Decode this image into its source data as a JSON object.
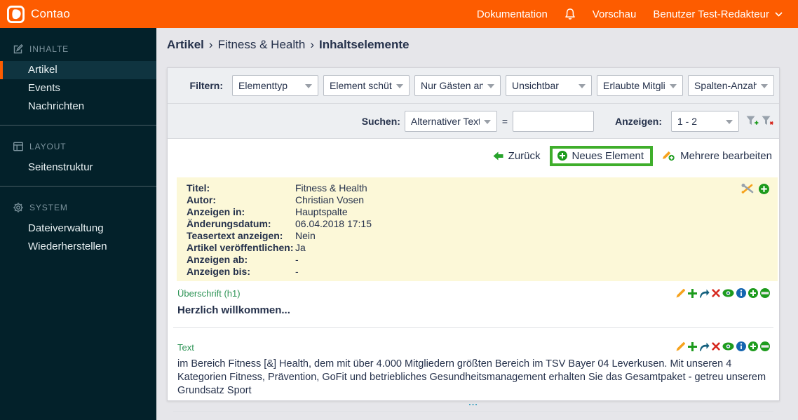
{
  "colors": {
    "accent_orange": "#fd5c00",
    "sidebar_bg": "#03212a",
    "highlight_green": "#3fae2b",
    "info_box_yellow": "#fcf8d8",
    "element_type_green": "#2e9456",
    "text_dark": "#25314b"
  },
  "header": {
    "brand": "Contao",
    "docs_label": "Dokumentation",
    "preview_label": "Vorschau",
    "user_label": "Benutzer Test-Redakteur"
  },
  "sidebar": {
    "sections": [
      {
        "label": "INHALTE",
        "items": [
          {
            "label": "Artikel",
            "active": true
          },
          {
            "label": "Events",
            "active": false
          },
          {
            "label": "Nachrichten",
            "active": false
          }
        ]
      },
      {
        "label": "LAYOUT",
        "items": [
          {
            "label": "Seitenstruktur",
            "active": false
          }
        ]
      },
      {
        "label": "SYSTEM",
        "items": [
          {
            "label": "Dateiverwaltung",
            "active": false
          },
          {
            "label": "Wiederherstellen",
            "active": false
          }
        ]
      }
    ]
  },
  "breadcrumb": {
    "part1": "Artikel",
    "sep1": "›",
    "part2": "Fitness & Health",
    "sep2": "›",
    "part3": "Inhaltselemente"
  },
  "filter_bar": {
    "label": "Filtern:",
    "dropdowns": [
      "Elementtyp",
      "Element schütze",
      "Nur Gästen anze",
      "Unsichtbar",
      "Erlaubte Mitglie",
      "Spalten-Anzahl"
    ]
  },
  "search_bar": {
    "label": "Suchen:",
    "field": "Alternativer Text",
    "operator": "=",
    "query": "",
    "show_label": "Anzeigen:",
    "range": "1 - 2"
  },
  "toolbar": {
    "back": "Zurück",
    "new_element": "Neues Element",
    "edit_multiple": "Mehrere bearbeiten"
  },
  "article_info": {
    "rows": [
      {
        "label": "Titel:",
        "value": "Fitness & Health"
      },
      {
        "label": "Autor:",
        "value": "Christian Vosen"
      },
      {
        "label": "Anzeigen in:",
        "value": "Hauptspalte"
      },
      {
        "label": "Änderungsdatum:",
        "value": "06.04.2018 17:15"
      },
      {
        "label": "Teasertext anzeigen:",
        "value": "Nein"
      },
      {
        "label": "Artikel veröffentlichen:",
        "value": "Ja"
      },
      {
        "label": "Anzeigen ab:",
        "value": "-"
      },
      {
        "label": "Anzeigen bis:",
        "value": "-"
      }
    ]
  },
  "elements": [
    {
      "type": "Überschrift (h1)",
      "text": "Herzlich willkommen..."
    },
    {
      "type": "Text",
      "text": "im Bereich Fitness [&] Health, dem mit über 4.000 Mitgliedern größten Bereich im TSV Bayer 04 Leverkusen. Mit unseren 4 Kategorien Fitness, Prävention, GoFit und betriebliches Gesundheitsmanagement erhalten Sie das Gesamtpaket - getreu unserem Grundsatz Sport",
      "more": "..."
    }
  ]
}
